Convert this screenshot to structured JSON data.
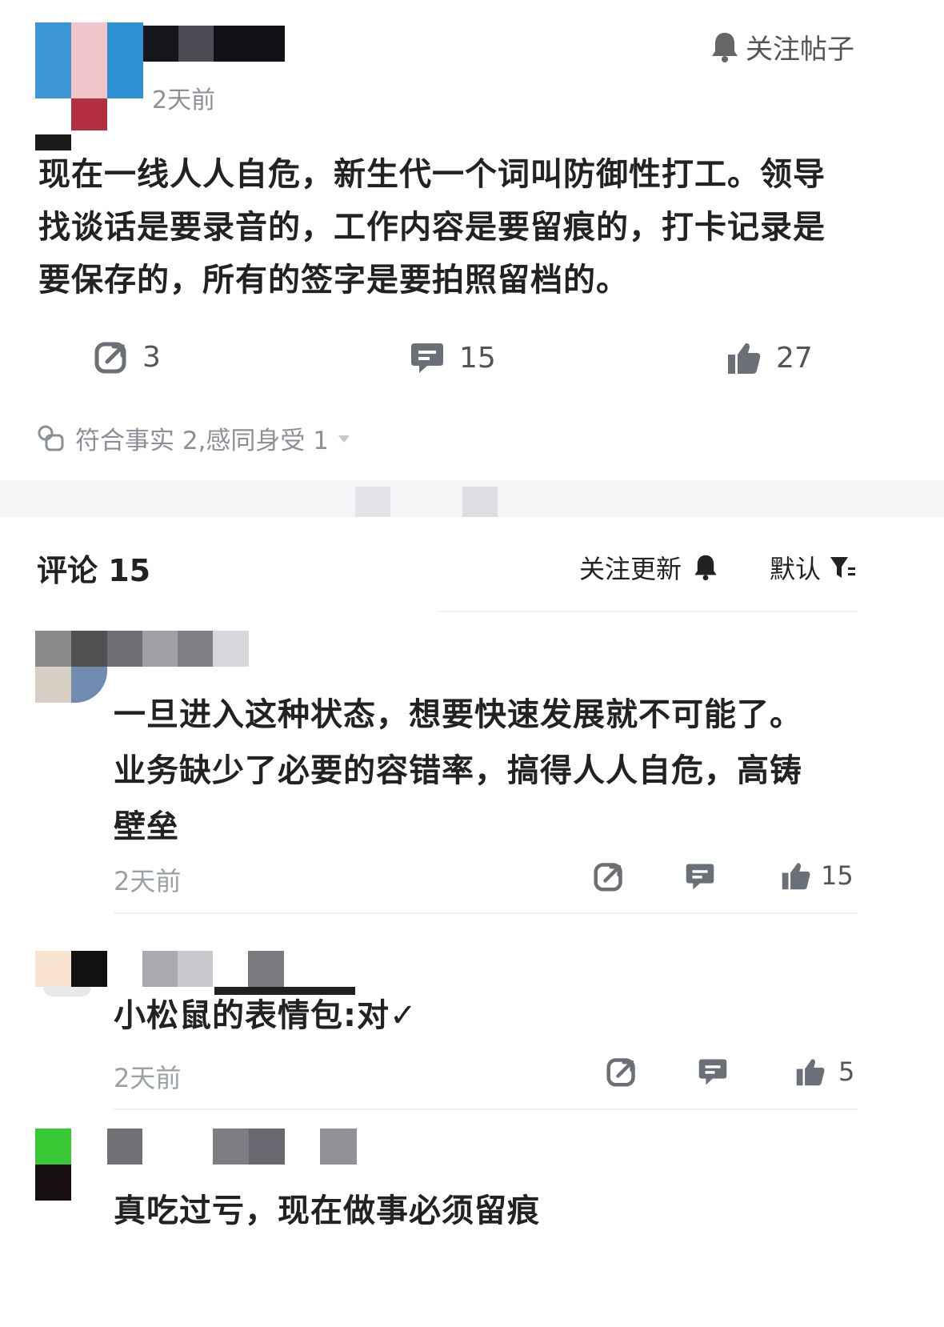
{
  "post": {
    "follow_label": "关注帖子",
    "time": "2天前",
    "body": "现在一线人人自危，新生代一个词叫防御性打工。领导找谈话是要录音的，工作内容是要留痕的，打卡记录是要保存的，所有的签字是要拍照留档的。",
    "stats": {
      "share": "3",
      "comments": "15",
      "likes": "27"
    },
    "reactions": "符合事实 2,感同身受 1"
  },
  "comments_header": {
    "title": "评论 15",
    "follow_updates": "关注更新",
    "sort": "默认"
  },
  "comments": [
    {
      "text": "一旦进入这种状态，想要快速发展就不可能了。业务缺少了必要的容错率，搞得人人自危，高铸壁垒",
      "time": "2天前",
      "likes": "15"
    },
    {
      "text": "小松鼠的表情包:对✓",
      "time": "2天前",
      "likes": "5"
    },
    {
      "text": "真吃过亏，现在做事必须留痕",
      "time": "",
      "likes": ""
    }
  ],
  "colors": {
    "text": "#222222",
    "muted": "#9aa0a8",
    "divider": "#f0f1f3"
  }
}
